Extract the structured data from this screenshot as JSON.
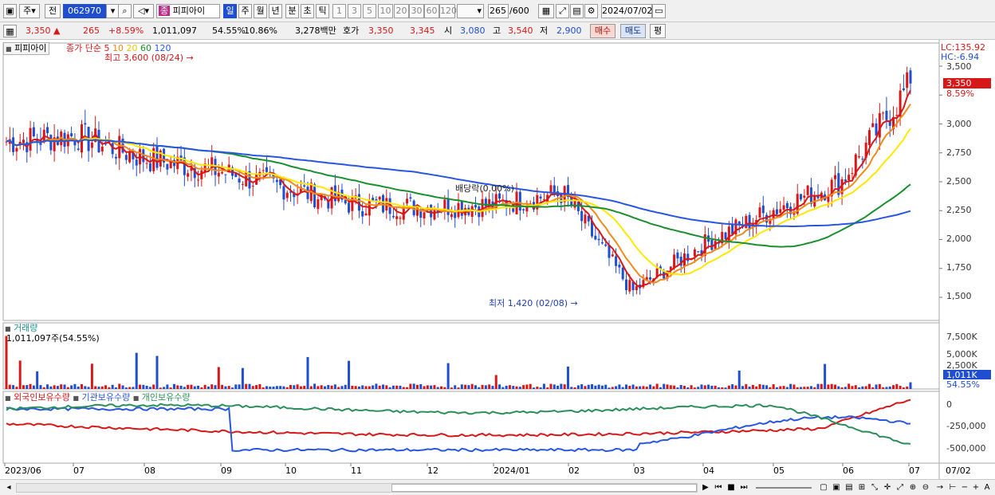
{
  "toolbar": {
    "stock_code": "062970",
    "type_label": "주",
    "prev_label": "전",
    "stock_name": "피피아이",
    "period_tabs": [
      "일",
      "주",
      "월",
      "년",
      "분",
      "초",
      "틱"
    ],
    "interval_buttons": [
      "1",
      "3",
      "5",
      "10",
      "20",
      "30",
      "60",
      "120"
    ],
    "count": "265",
    "count_max": "/600",
    "date": "2024/07/02"
  },
  "quote": {
    "price": "3,350",
    "change": "265",
    "change_pct": "+8.59%",
    "volume": "1,011,097",
    "vol_ratio": "54.55%",
    "turnover_pct": "10.86%",
    "amount": "3,278백만",
    "hoga_label": "호가",
    "ask": "3,350",
    "bid": "3,345",
    "open_label": "시",
    "open": "3,080",
    "high_label": "고",
    "high": "3,540",
    "low_label": "저",
    "low": "2,900",
    "buy_label": "매수",
    "sell_label": "매도",
    "eval_label": "평"
  },
  "price_panel": {
    "name_tag": "피피아이",
    "ma_title": "종가 단순",
    "ma_periods": [
      "5",
      "10",
      "20",
      "60",
      "120"
    ],
    "ma_colors": [
      "#d81818",
      "#f08a1a",
      "#ffe800",
      "#1a8f2e",
      "#2856e0"
    ],
    "high_note": "최고 3,600 (08/24)",
    "low_note": "최저 1,420 (02/08)",
    "dividend_note": "배당락(0.00%)",
    "lc": "LC:135.92",
    "hc": "HC:-6.94",
    "current_price": "3,350",
    "current_pct": "8.59%",
    "y_ticks": [
      "3,500",
      "3,250",
      "3,000",
      "2,750",
      "2,500",
      "2,250",
      "2,000",
      "1,750",
      "1,500"
    ]
  },
  "volume_panel": {
    "title": "거래량",
    "value": "1,011,097주(54.55%)",
    "y_ticks": [
      "7,500K",
      "5,000K",
      "2,500K"
    ],
    "current": "1,011K",
    "current_pct": "54.55%"
  },
  "holding_panel": {
    "legend": [
      "외국인보유수량",
      "기관보유수량",
      "개인보유수량"
    ],
    "colors": [
      "#d81818",
      "#2856e0",
      "#2a8f5a"
    ],
    "y_ticks": [
      "0",
      "-250,000",
      "-500,000"
    ]
  },
  "x_axis": {
    "labels": [
      "2023/06",
      "07",
      "08",
      "09",
      "10",
      "11",
      "12",
      "2024/01",
      "02",
      "03",
      "04",
      "05",
      "06",
      "07"
    ],
    "last_date": "07/02"
  },
  "chart_data": {
    "type": "line",
    "title": "",
    "x": [
      "2023/06",
      "07",
      "08",
      "09",
      "10",
      "11",
      "12",
      "2024/01",
      "02",
      "03",
      "04",
      "05",
      "06",
      "07"
    ],
    "ylim": [
      1300,
      3700
    ],
    "series": [
      {
        "name": "종가",
        "values": [
          2850,
          2900,
          2700,
          2600,
          2450,
          2300,
          2280,
          2300,
          2400,
          1550,
          1950,
          2250,
          2500,
          3350
        ]
      },
      {
        "name": "120",
        "values": [
          2800,
          2880,
          2850,
          2720,
          2650,
          2560,
          2500,
          2430,
          2380,
          2200,
          2120,
          2100,
          2120,
          2220
        ]
      }
    ],
    "annotations": {
      "high": "3,600 (08/24)",
      "low": "1,420 (02/08)"
    }
  }
}
